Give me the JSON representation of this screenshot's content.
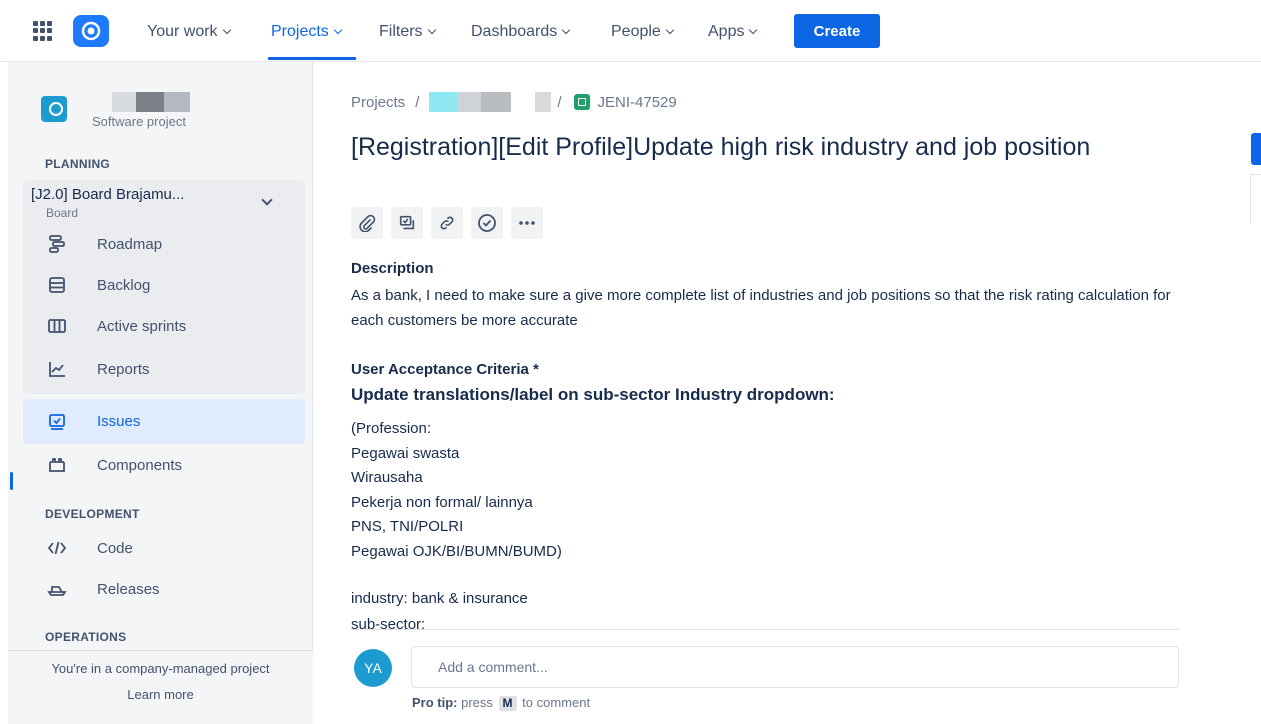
{
  "topnav": {
    "items": [
      {
        "label": "Your work"
      },
      {
        "label": "Projects"
      },
      {
        "label": "Filters"
      },
      {
        "label": "Dashboards"
      },
      {
        "label": "People"
      },
      {
        "label": "Apps"
      }
    ],
    "active_item": "Projects",
    "create_label": "Create"
  },
  "sidebar": {
    "project_type": "Software project",
    "planning_head": "PLANNING",
    "board_title": "[J2.0] Board Brajamu...",
    "board_sub": "Board",
    "planning_items": [
      {
        "label": "Roadmap",
        "icon": "roadmap-icon"
      },
      {
        "label": "Backlog",
        "icon": "backlog-icon"
      },
      {
        "label": "Active sprints",
        "icon": "active-sprints-icon"
      },
      {
        "label": "Reports",
        "icon": "reports-icon"
      }
    ],
    "issues_label": "Issues",
    "components_label": "Components",
    "development_head": "DEVELOPMENT",
    "code_label": "Code",
    "releases_label": "Releases",
    "operations_head": "OPERATIONS",
    "footer_text": "You're in a company-managed project",
    "learn_more": "Learn more"
  },
  "issue": {
    "breadcrumb_root": "Projects",
    "breadcrumb_sep": "/",
    "key": "JENI-47529",
    "title": "[Registration][Edit Profile]Update high risk industry and job position",
    "description_head": "Description",
    "description": "As a bank, I need to make sure a give more complete list of industries and job positions so that the risk rating calculation for each customers be more accurate",
    "uac_head": "User Acceptance Criteria *",
    "uac_sub": "Update translations/label on sub-sector Industry dropdown:",
    "uac_lines": [
      "(Profession:",
      "Pegawai swasta",
      "Wirausaha",
      "Pekerja non formal/ lainnya",
      "PNS, TNI/POLRI",
      "Pegawai OJK/BI/BUMN/BUMD)",
      "",
      "industry: bank & insurance",
      "sub-sector:"
    ]
  },
  "comment": {
    "avatar_initials": "YA",
    "placeholder": "Add a comment...",
    "tip_bold": "Pro tip:",
    "tip_press": "press",
    "tip_key": "M",
    "tip_rest": "to comment"
  },
  "colors": {
    "accent": "#0c66e4",
    "sidebar_bg": "#f4f5f7",
    "selected_bg": "#e0ebfd",
    "avatar": "#1d9bd1",
    "story": "#22a06b"
  }
}
